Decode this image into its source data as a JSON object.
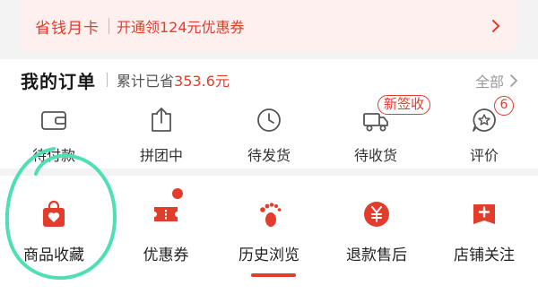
{
  "banner": {
    "title": "省钱月卡",
    "description": "开通领124元优惠券"
  },
  "orders": {
    "title": "我的订单",
    "saved_label": "累计已省",
    "saved_value": "353.6元",
    "view_all": "全部",
    "statuses": [
      {
        "label": "待付款",
        "icon": "wallet-icon"
      },
      {
        "label": "拼团中",
        "icon": "share-box-icon"
      },
      {
        "label": "待发货",
        "icon": "clock-icon"
      },
      {
        "label": "待收货",
        "icon": "truck-icon",
        "tag": "新签收"
      },
      {
        "label": "评价",
        "icon": "star-bubble-icon",
        "count": "6"
      }
    ]
  },
  "tools": [
    {
      "label": "商品收藏",
      "icon": "heart-bag-icon"
    },
    {
      "label": "优惠券",
      "icon": "ticket-icon",
      "dot": true
    },
    {
      "label": "历史浏览",
      "icon": "footprint-icon"
    },
    {
      "label": "退款售后",
      "icon": "yen-circle-icon"
    },
    {
      "label": "店铺关注",
      "icon": "plus-shield-icon"
    }
  ],
  "colors": {
    "accent": "#e23c2c",
    "annotation": "#4ee0b4"
  }
}
